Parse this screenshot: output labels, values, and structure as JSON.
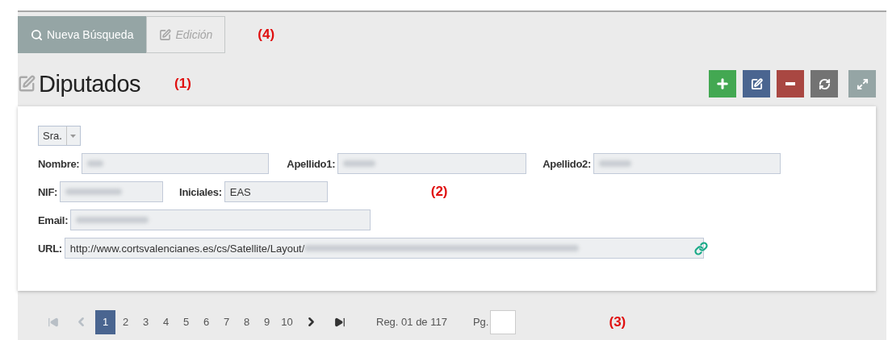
{
  "tabs": [
    {
      "label": "Nueva Búsqueda",
      "selected": true
    },
    {
      "label": "Edición",
      "selected": false
    }
  ],
  "callouts": [
    {
      "label": "(4)"
    },
    {
      "label": "(1)"
    },
    {
      "label": "(2)"
    },
    {
      "label": "(3)"
    }
  ],
  "title": "Diputados",
  "toolbar": [
    {
      "kind": "add",
      "color": "#43a852"
    },
    {
      "kind": "edit",
      "color": "#4a6590"
    },
    {
      "kind": "remove",
      "color": "#a94742"
    },
    {
      "kind": "refresh",
      "color": "#737373"
    },
    {
      "kind": "expand",
      "color": "#95a5a5"
    }
  ],
  "form": {
    "treatment": {
      "value": "Sra."
    },
    "rows": [
      [
        {
          "label": "Nombre:",
          "redacted": true
        },
        {
          "label": "Apellido1:",
          "redacted": true
        },
        {
          "label": "Apellido2:",
          "redacted": true
        }
      ],
      [
        {
          "label": "NIF:",
          "redacted": true
        },
        {
          "label": "Iniciales:",
          "value": "EAS"
        }
      ],
      [
        {
          "label": "Email:",
          "redacted": true
        }
      ],
      [
        {
          "label": "URL:",
          "value": "http://www.cortsvalencianes.es/cs/Satellite/Layout/",
          "redacted": true,
          "link": true
        }
      ]
    ]
  },
  "pagination": {
    "nav_before": [
      {
        "kind": "first",
        "disabled": true
      },
      {
        "kind": "prev",
        "disabled": true
      }
    ],
    "pages": [
      {
        "label": "1",
        "selected": true
      },
      {
        "label": "2",
        "selected": false
      },
      {
        "label": "3",
        "selected": false
      },
      {
        "label": "4",
        "selected": false
      },
      {
        "label": "5",
        "selected": false
      },
      {
        "label": "6",
        "selected": false
      },
      {
        "label": "7",
        "selected": false
      },
      {
        "label": "8",
        "selected": false
      },
      {
        "label": "9",
        "selected": false
      },
      {
        "label": "10",
        "selected": false
      }
    ],
    "nav_after": [
      {
        "kind": "next",
        "disabled": false
      },
      {
        "kind": "last",
        "disabled": false
      }
    ],
    "records": "Reg. 01 de 117",
    "page_label": "Pg."
  }
}
